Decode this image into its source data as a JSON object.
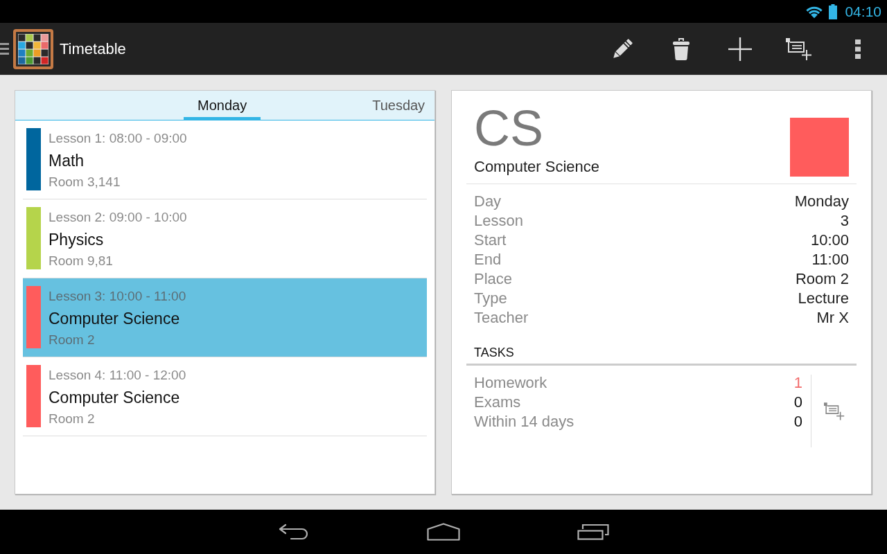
{
  "status_bar": {
    "time": "04:10"
  },
  "action_bar": {
    "title": "Timetable"
  },
  "day_tabs": [
    {
      "label": "Monday",
      "selected": true
    },
    {
      "label": "Tuesday",
      "selected": false
    }
  ],
  "lessons": [
    {
      "time": "Lesson 1: 08:00 - 09:00",
      "subject": "Math",
      "room": "Room 3,141",
      "color": "#00669e",
      "selected": false
    },
    {
      "time": "Lesson 2: 09:00 - 10:00",
      "subject": "Physics",
      "room": "Room 9,81",
      "color": "#b5d44b",
      "selected": false
    },
    {
      "time": "Lesson 3: 10:00 - 11:00",
      "subject": "Computer Science",
      "room": "Room 2",
      "color": "#ff5c5c",
      "selected": true
    },
    {
      "time": "Lesson 4: 11:00 - 12:00",
      "subject": "Computer Science",
      "room": "Room 2",
      "color": "#ff5c5c",
      "selected": false
    }
  ],
  "lesson_detail": {
    "abbreviation": "CS",
    "subject": "Computer Science",
    "color": "#ff5c5c",
    "fields": [
      {
        "label": "Day",
        "value": "Monday"
      },
      {
        "label": "Lesson",
        "value": "3"
      },
      {
        "label": "Start",
        "value": "10:00"
      },
      {
        "label": "End",
        "value": "11:00"
      },
      {
        "label": "Place",
        "value": "Room 2"
      },
      {
        "label": "Type",
        "value": "Lecture"
      },
      {
        "label": "Teacher",
        "value": "Mr X"
      }
    ],
    "tasks_heading": "TASKS",
    "tasks": [
      {
        "label": "Homework",
        "count": "1",
        "highlighted": true
      },
      {
        "label": "Exams",
        "count": "0",
        "highlighted": false
      },
      {
        "label": "Within 14 days",
        "count": "0",
        "highlighted": false
      }
    ]
  }
}
